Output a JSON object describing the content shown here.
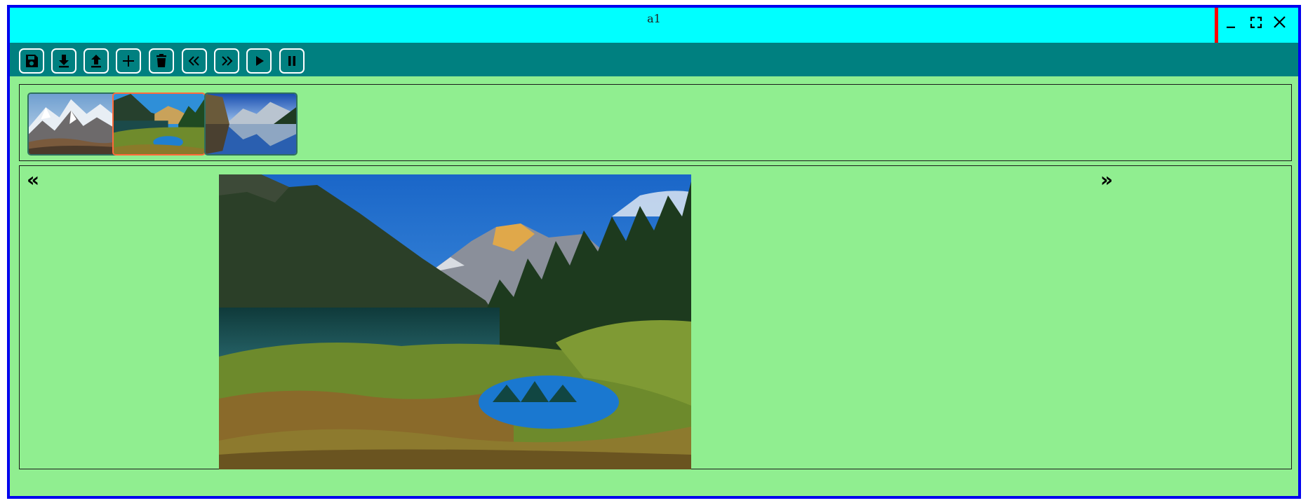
{
  "window": {
    "title": "a1",
    "controls": [
      {
        "name": "minimize-button",
        "icon": "minimize-icon"
      },
      {
        "name": "maximize-button",
        "icon": "maximize-icon"
      },
      {
        "name": "close-button",
        "icon": "close-icon"
      }
    ]
  },
  "toolbar": {
    "buttons": [
      {
        "name": "save-button",
        "icon": "save-icon"
      },
      {
        "name": "download-button",
        "icon": "download-icon"
      },
      {
        "name": "upload-button",
        "icon": "upload-icon"
      },
      {
        "name": "add-button",
        "icon": "plus-icon"
      },
      {
        "name": "delete-button",
        "icon": "trash-icon"
      },
      {
        "name": "previous-button",
        "icon": "double-chevron-left-icon"
      },
      {
        "name": "next-button",
        "icon": "double-chevron-right-icon"
      },
      {
        "name": "play-button",
        "icon": "play-icon"
      },
      {
        "name": "pause-button",
        "icon": "pause-icon"
      }
    ]
  },
  "gallery": {
    "thumbnails": [
      {
        "name": "thumbnail-snowy-mountains",
        "selected": false
      },
      {
        "name": "thumbnail-mountain-lake-forest",
        "selected": true
      },
      {
        "name": "thumbnail-lake-reflection",
        "selected": false
      }
    ],
    "selected_index": 1
  },
  "viewer": {
    "prev_label": "«",
    "next_label": "»",
    "image": "mountain-lake-forest"
  },
  "colors": {
    "border": "#0000ee",
    "titlebar": "#00ffff",
    "toolbar": "#008080",
    "content": "#90ee90",
    "title_separator": "#ff0000",
    "selected_thumbnail": "#ff6a3a"
  }
}
